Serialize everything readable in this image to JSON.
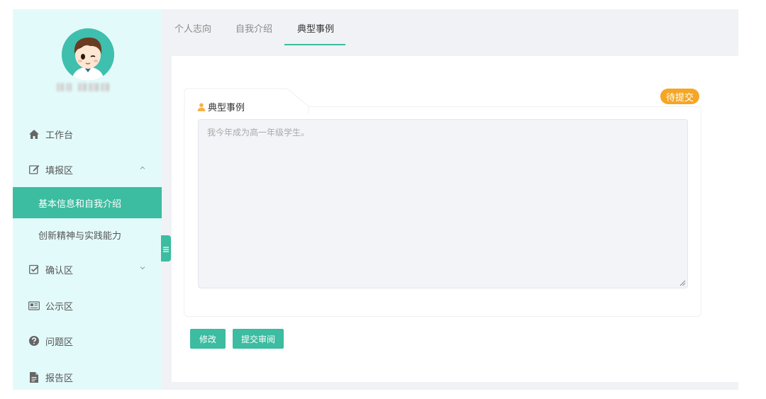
{
  "sidebar": {
    "items": [
      {
        "label": "工作台",
        "icon": "home-icon"
      },
      {
        "label": "填报区",
        "icon": "edit-icon",
        "expanded": true
      },
      {
        "label": "确认区",
        "icon": "check-square-icon",
        "expanded": false
      },
      {
        "label": "公示区",
        "icon": "newspaper-icon"
      },
      {
        "label": "问题区",
        "icon": "question-circle-icon"
      },
      {
        "label": "报告区",
        "icon": "file-icon"
      }
    ],
    "subitems": [
      {
        "label": "基本信息和自我介绍",
        "active": true
      },
      {
        "label": "创新精神与实践能力",
        "active": false
      }
    ]
  },
  "tabs": [
    {
      "label": "个人志向"
    },
    {
      "label": "自我介绍"
    },
    {
      "label": "典型事例",
      "active": true
    }
  ],
  "card": {
    "title": "典型事例",
    "status": "待提交",
    "textarea_value": "我今年成为高一年级学生。"
  },
  "buttons": {
    "edit_label": "修改",
    "submit_label": "提交审阅"
  },
  "colors": {
    "accent": "#3cbca0",
    "sidebar_bg": "#e3fafa",
    "status_orange": "#f5a623",
    "title_icon_orange": "#f5b14a"
  }
}
